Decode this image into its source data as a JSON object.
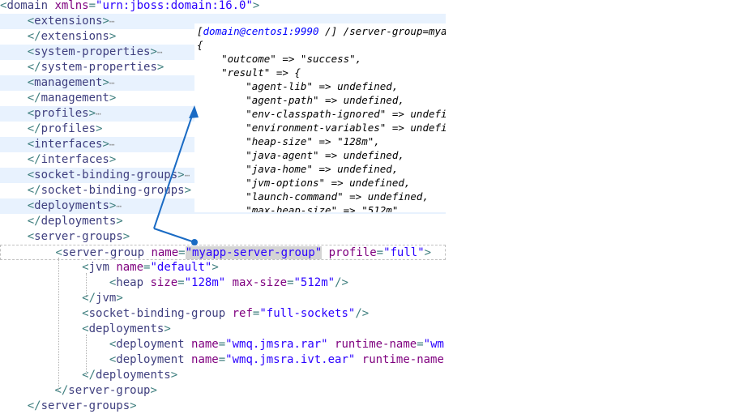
{
  "editor": {
    "lines": [
      {
        "indent": "",
        "parts": [
          [
            "tg",
            "<"
          ],
          [
            "tn",
            "domain "
          ],
          [
            "an",
            "xmlns"
          ],
          [
            "tg",
            "="
          ],
          [
            "av",
            "\"urn:jboss:domain:16.0\""
          ],
          [
            "tg",
            ">"
          ]
        ]
      },
      {
        "indent": "    ",
        "parts": [
          [
            "tg",
            "<"
          ],
          [
            "tn",
            "extensions"
          ],
          [
            "tg",
            ">"
          ]
        ],
        "fold": "⋯"
      },
      {
        "indent": "    ",
        "parts": [
          [
            "tg",
            "</"
          ],
          [
            "tn",
            "extensions"
          ],
          [
            "tg",
            ">"
          ]
        ]
      },
      {
        "indent": "    ",
        "parts": [
          [
            "tg",
            "<"
          ],
          [
            "tn",
            "system-properties"
          ],
          [
            "tg",
            ">"
          ]
        ],
        "fold": "⋯"
      },
      {
        "indent": "    ",
        "parts": [
          [
            "tg",
            "</"
          ],
          [
            "tn",
            "system-properties"
          ],
          [
            "tg",
            ">"
          ]
        ]
      },
      {
        "indent": "    ",
        "parts": [
          [
            "tg",
            "<"
          ],
          [
            "tn",
            "management"
          ],
          [
            "tg",
            ">"
          ]
        ],
        "fold": "⋯"
      },
      {
        "indent": "    ",
        "parts": [
          [
            "tg",
            "</"
          ],
          [
            "tn",
            "management"
          ],
          [
            "tg",
            ">"
          ]
        ]
      },
      {
        "indent": "    ",
        "parts": [
          [
            "tg",
            "<"
          ],
          [
            "tn",
            "profiles"
          ],
          [
            "tg",
            ">"
          ]
        ],
        "fold": "⋯"
      },
      {
        "indent": "    ",
        "parts": [
          [
            "tg",
            "</"
          ],
          [
            "tn",
            "profiles"
          ],
          [
            "tg",
            ">"
          ]
        ]
      },
      {
        "indent": "    ",
        "parts": [
          [
            "tg",
            "<"
          ],
          [
            "tn",
            "interfaces"
          ],
          [
            "tg",
            ">"
          ]
        ],
        "fold": "⋯"
      },
      {
        "indent": "    ",
        "parts": [
          [
            "tg",
            "</"
          ],
          [
            "tn",
            "interfaces"
          ],
          [
            "tg",
            ">"
          ]
        ]
      },
      {
        "indent": "    ",
        "parts": [
          [
            "tg",
            "<"
          ],
          [
            "tn",
            "socket-binding-groups"
          ],
          [
            "tg",
            ">"
          ]
        ],
        "fold": "⋯"
      },
      {
        "indent": "    ",
        "parts": [
          [
            "tg",
            "</"
          ],
          [
            "tn",
            "socket-binding-groups"
          ],
          [
            "tg",
            ">"
          ]
        ]
      },
      {
        "indent": "    ",
        "parts": [
          [
            "tg",
            "<"
          ],
          [
            "tn",
            "deployments"
          ],
          [
            "tg",
            ">"
          ]
        ],
        "fold": "⋯"
      },
      {
        "indent": "    ",
        "parts": [
          [
            "tg",
            "</"
          ],
          [
            "tn",
            "deployments"
          ],
          [
            "tg",
            ">"
          ]
        ]
      },
      {
        "indent": "    ",
        "parts": [
          [
            "tg",
            "<"
          ],
          [
            "tn",
            "server-groups"
          ],
          [
            "tg",
            ">"
          ]
        ]
      },
      {
        "indent": "        ",
        "parts": [
          [
            "tg",
            "<"
          ],
          [
            "tn",
            "server-group "
          ],
          [
            "an",
            "name"
          ],
          [
            "tg",
            "="
          ],
          [
            "hlav",
            "\"myapp-server-group\""
          ],
          [
            "tg",
            " "
          ],
          [
            "an",
            "profile"
          ],
          [
            "tg",
            "="
          ],
          [
            "av",
            "\"full\""
          ],
          [
            "tg",
            ">"
          ]
        ]
      },
      {
        "indent": "            ",
        "parts": [
          [
            "tg",
            "<"
          ],
          [
            "tn",
            "jvm "
          ],
          [
            "an",
            "name"
          ],
          [
            "tg",
            "="
          ],
          [
            "av",
            "\"default\""
          ],
          [
            "tg",
            ">"
          ]
        ]
      },
      {
        "indent": "                ",
        "parts": [
          [
            "tg",
            "<"
          ],
          [
            "tn",
            "heap "
          ],
          [
            "an",
            "size"
          ],
          [
            "tg",
            "="
          ],
          [
            "av",
            "\"128m\""
          ],
          [
            "tg",
            " "
          ],
          [
            "an",
            "max-size"
          ],
          [
            "tg",
            "="
          ],
          [
            "av",
            "\"512m\""
          ],
          [
            "tg",
            "/>"
          ]
        ]
      },
      {
        "indent": "            ",
        "parts": [
          [
            "tg",
            "</"
          ],
          [
            "tn",
            "jvm"
          ],
          [
            "tg",
            ">"
          ]
        ]
      },
      {
        "indent": "            ",
        "parts": [
          [
            "tg",
            "<"
          ],
          [
            "tn",
            "socket-binding-group "
          ],
          [
            "an",
            "ref"
          ],
          [
            "tg",
            "="
          ],
          [
            "av",
            "\"full-sockets\""
          ],
          [
            "tg",
            "/>"
          ]
        ]
      },
      {
        "indent": "            ",
        "parts": [
          [
            "tg",
            "<"
          ],
          [
            "tn",
            "deployments"
          ],
          [
            "tg",
            ">"
          ]
        ]
      },
      {
        "indent": "                ",
        "parts": [
          [
            "tg",
            "<"
          ],
          [
            "tn",
            "deployment "
          ],
          [
            "an",
            "name"
          ],
          [
            "tg",
            "="
          ],
          [
            "av",
            "\"wmq.jmsra.rar\""
          ],
          [
            "tg",
            " "
          ],
          [
            "an",
            "runtime-name"
          ],
          [
            "tg",
            "="
          ],
          [
            "av",
            "\"wm"
          ]
        ]
      },
      {
        "indent": "                ",
        "parts": [
          [
            "tg",
            "<"
          ],
          [
            "tn",
            "deployment "
          ],
          [
            "an",
            "name"
          ],
          [
            "tg",
            "="
          ],
          [
            "av",
            "\"wmq.jmsra.ivt.ear\""
          ],
          [
            "tg",
            " "
          ],
          [
            "an",
            "runtime-name"
          ]
        ]
      },
      {
        "indent": "            ",
        "parts": [
          [
            "tg",
            "</"
          ],
          [
            "tn",
            "deployments"
          ],
          [
            "tg",
            ">"
          ]
        ]
      },
      {
        "indent": "        ",
        "parts": [
          [
            "tg",
            "</"
          ],
          [
            "tn",
            "server-group"
          ],
          [
            "tg",
            ">"
          ]
        ]
      },
      {
        "indent": "    ",
        "parts": [
          [
            "tg",
            "</"
          ],
          [
            "tn",
            "server-groups"
          ],
          [
            "tg",
            ">"
          ]
        ]
      }
    ]
  },
  "console": {
    "prompt_user": "domain@centos1:9990",
    "prompt_rest": " /] /server-group=myapp-server-group/jvm=default:read-resource",
    "lines": [
      "{",
      "    \"outcome\" => \"success\",",
      "    \"result\" => {",
      "        \"agent-lib\" => undefined,",
      "        \"agent-path\" => undefined,",
      "        \"env-classpath-ignored\" => undefined,",
      "        \"environment-variables\" => undefined,",
      "        \"heap-size\" => \"128m\",",
      "        \"java-agent\" => undefined,",
      "        \"java-home\" => undefined,",
      "        \"jvm-options\" => undefined,",
      "        \"launch-command\" => undefined,",
      "        \"max-heap-size\" => \"512m\","
    ]
  },
  "colors": {
    "tag": "#3f7f7f",
    "attr_name": "#7f007f",
    "attr_value": "#2a00ff",
    "arrow": "#1a6bc4",
    "alt_row": "#e8f2fe"
  }
}
